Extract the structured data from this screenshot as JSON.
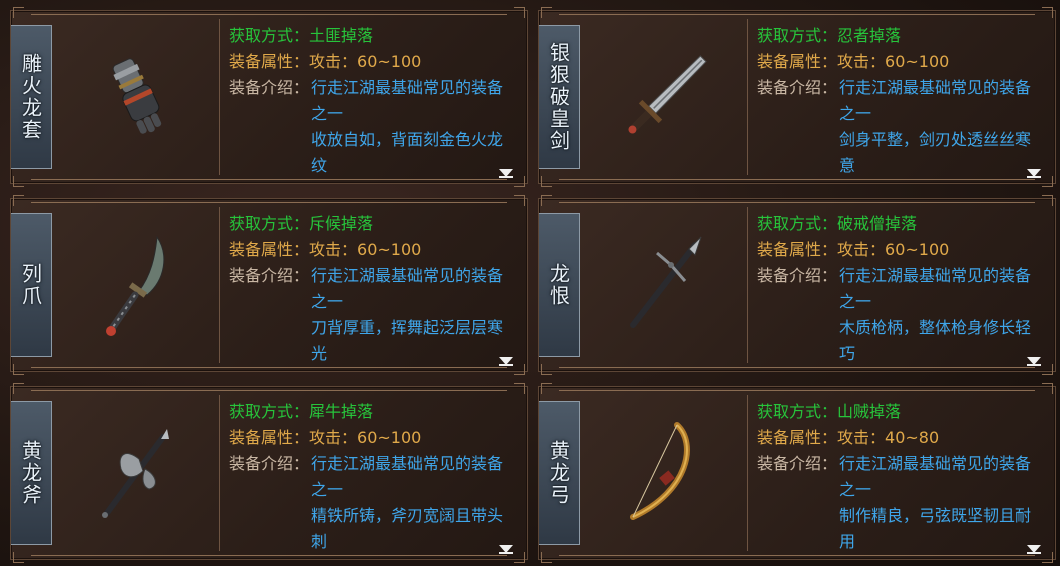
{
  "labels": {
    "source": "获取方式：",
    "attribute": "装备属性：",
    "description": "装备介绍："
  },
  "cards": [
    {
      "name": "雕火龙套",
      "source": "土匪掉落",
      "attribute": "攻击：60~100",
      "desc": "行走江湖最基础常见的装备之一\n收放自如，背面刻金色火龙纹",
      "icon": "gauntlet-icon"
    },
    {
      "name": "银狠破皇剑",
      "source": "忍者掉落",
      "attribute": "攻击：60~100",
      "desc": "行走江湖最基础常见的装备之一\n剑身平整，剑刃处透丝丝寒意",
      "icon": "sword-icon"
    },
    {
      "name": "列爪",
      "source": "斥候掉落",
      "attribute": "攻击：60~100",
      "desc": "行走江湖最基础常见的装备之一\n刀背厚重，挥舞起泛层层寒光",
      "icon": "saber-icon"
    },
    {
      "name": "龙恨",
      "source": "破戒僧掉落",
      "attribute": "攻击：60~100",
      "desc": "行走江湖最基础常见的装备之一\n木质枪柄，整体枪身修长轻巧",
      "icon": "spear-icon"
    },
    {
      "name": "黄龙斧",
      "source": "犀牛掉落",
      "attribute": "攻击：60~100",
      "desc": "行走江湖最基础常见的装备之一\n精铁所铸，斧刃宽阔且带头刺",
      "icon": "axe-icon"
    },
    {
      "name": "黄龙弓",
      "source": "山贼掉落",
      "attribute": "攻击：40~80",
      "desc": "行走江湖最基础常见的装备之一\n制作精良，弓弦既坚韧且耐用",
      "icon": "bow-icon"
    }
  ]
}
